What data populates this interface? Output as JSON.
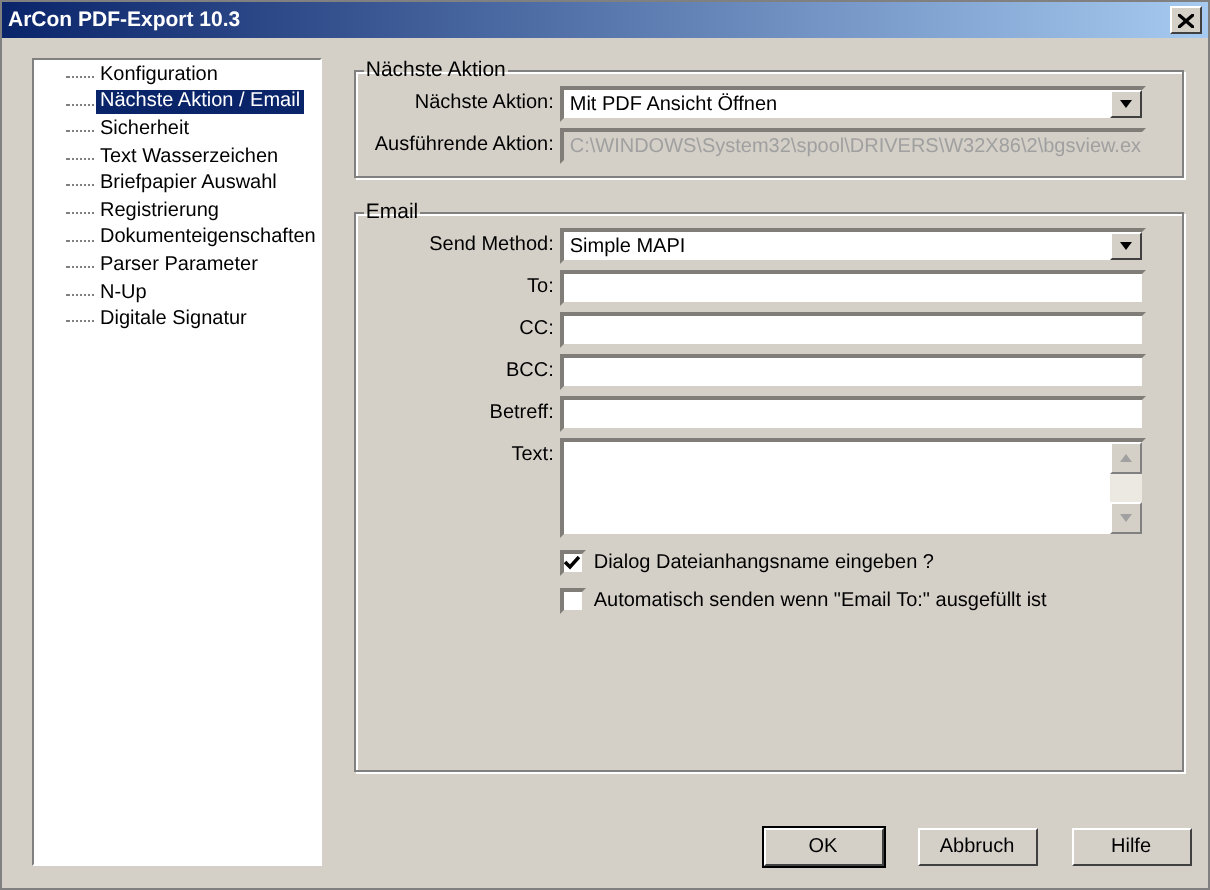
{
  "window": {
    "title": "ArCon PDF-Export 10.3"
  },
  "tree": [
    {
      "label": "Konfiguration",
      "selected": false
    },
    {
      "label": "Nächste Aktion / Email",
      "selected": true
    },
    {
      "label": "Sicherheit",
      "selected": false
    },
    {
      "label": "Text Wasserzeichen",
      "selected": false
    },
    {
      "label": "Briefpapier Auswahl",
      "selected": false
    },
    {
      "label": "Registrierung",
      "selected": false
    },
    {
      "label": "Dokumenteigenschaften",
      "selected": false
    },
    {
      "label": "Parser Parameter",
      "selected": false
    },
    {
      "label": "N-Up",
      "selected": false
    },
    {
      "label": "Digitale Signatur",
      "selected": false
    }
  ],
  "groups": [
    {
      "title": "Nächste Aktion",
      "fields": [
        {
          "label": "Nächste Aktion:",
          "kind": "dropdown",
          "value": "Mit PDF Ansicht Öffnen"
        },
        {
          "label": "Ausführende Aktion:",
          "kind": "disabled",
          "value": "C:\\WINDOWS\\System32\\spool\\DRIVERS\\W32X86\\2\\bgsview.ex"
        }
      ]
    },
    {
      "title": "Email",
      "fields": [
        {
          "label": "Send Method:",
          "kind": "dropdown",
          "value": "Simple MAPI"
        },
        {
          "label": "To:",
          "kind": "text"
        },
        {
          "label": "CC:",
          "kind": "text"
        },
        {
          "label": "BCC:",
          "kind": "text"
        },
        {
          "label": "Betreff:",
          "kind": "text"
        },
        {
          "label": "Text:",
          "kind": "textarea"
        }
      ],
      "checkboxes": [
        {
          "label": "Dialog Dateianhangsname eingeben ?",
          "checked": true
        },
        {
          "label": "Automatisch senden wenn \"Email To:\" ausgefüllt ist",
          "checked": false
        }
      ]
    }
  ],
  "buttons": [
    {
      "label": "OK",
      "default": true
    },
    {
      "label": "Abbruch",
      "default": false
    },
    {
      "label": "Hilfe",
      "default": false
    }
  ]
}
